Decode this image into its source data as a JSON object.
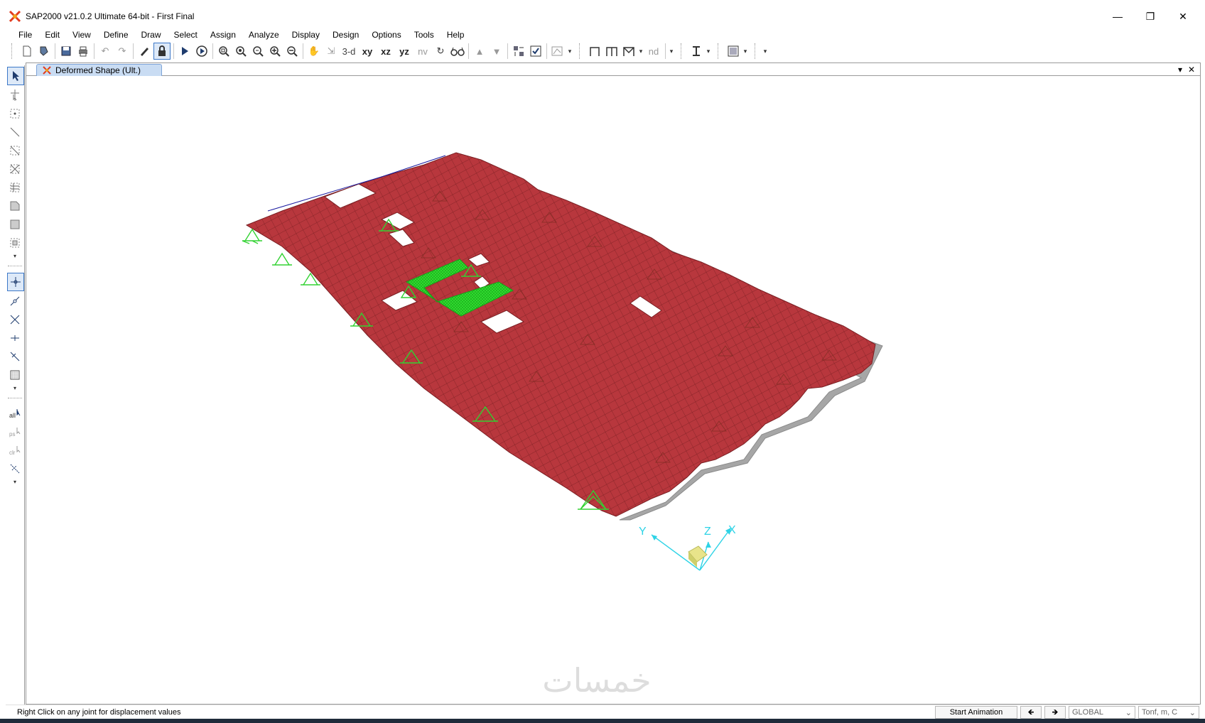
{
  "window": {
    "title": "SAP2000 v21.0.2 Ultimate 64-bit - First Final",
    "controls": [
      "—",
      "❐",
      "✕"
    ]
  },
  "menu": [
    "File",
    "Edit",
    "View",
    "Define",
    "Draw",
    "Select",
    "Assign",
    "Analyze",
    "Display",
    "Design",
    "Options",
    "Tools",
    "Help"
  ],
  "toolbar": {
    "view_3d": "3-d",
    "view_xy": "xy",
    "view_xz": "xz",
    "view_yz": "yz",
    "view_nv": "nv",
    "nd": "nd"
  },
  "tab": {
    "label": "Deformed Shape (Ult.)"
  },
  "axes": {
    "y": "Y",
    "z": "Z",
    "x": "X"
  },
  "colors": {
    "slab": "#b8373d",
    "mesh": "#6e1a1d",
    "support": "#32d232",
    "undeformed": "#9c9c9c",
    "axis": "#2ed3e6",
    "core": "#30e030"
  },
  "status": {
    "message": "Right Click on any joint for displacement values",
    "start_animation": "Start Animation",
    "coord_system": "GLOBAL",
    "units": "Tonf, m, C"
  },
  "watermark": "خمسات"
}
